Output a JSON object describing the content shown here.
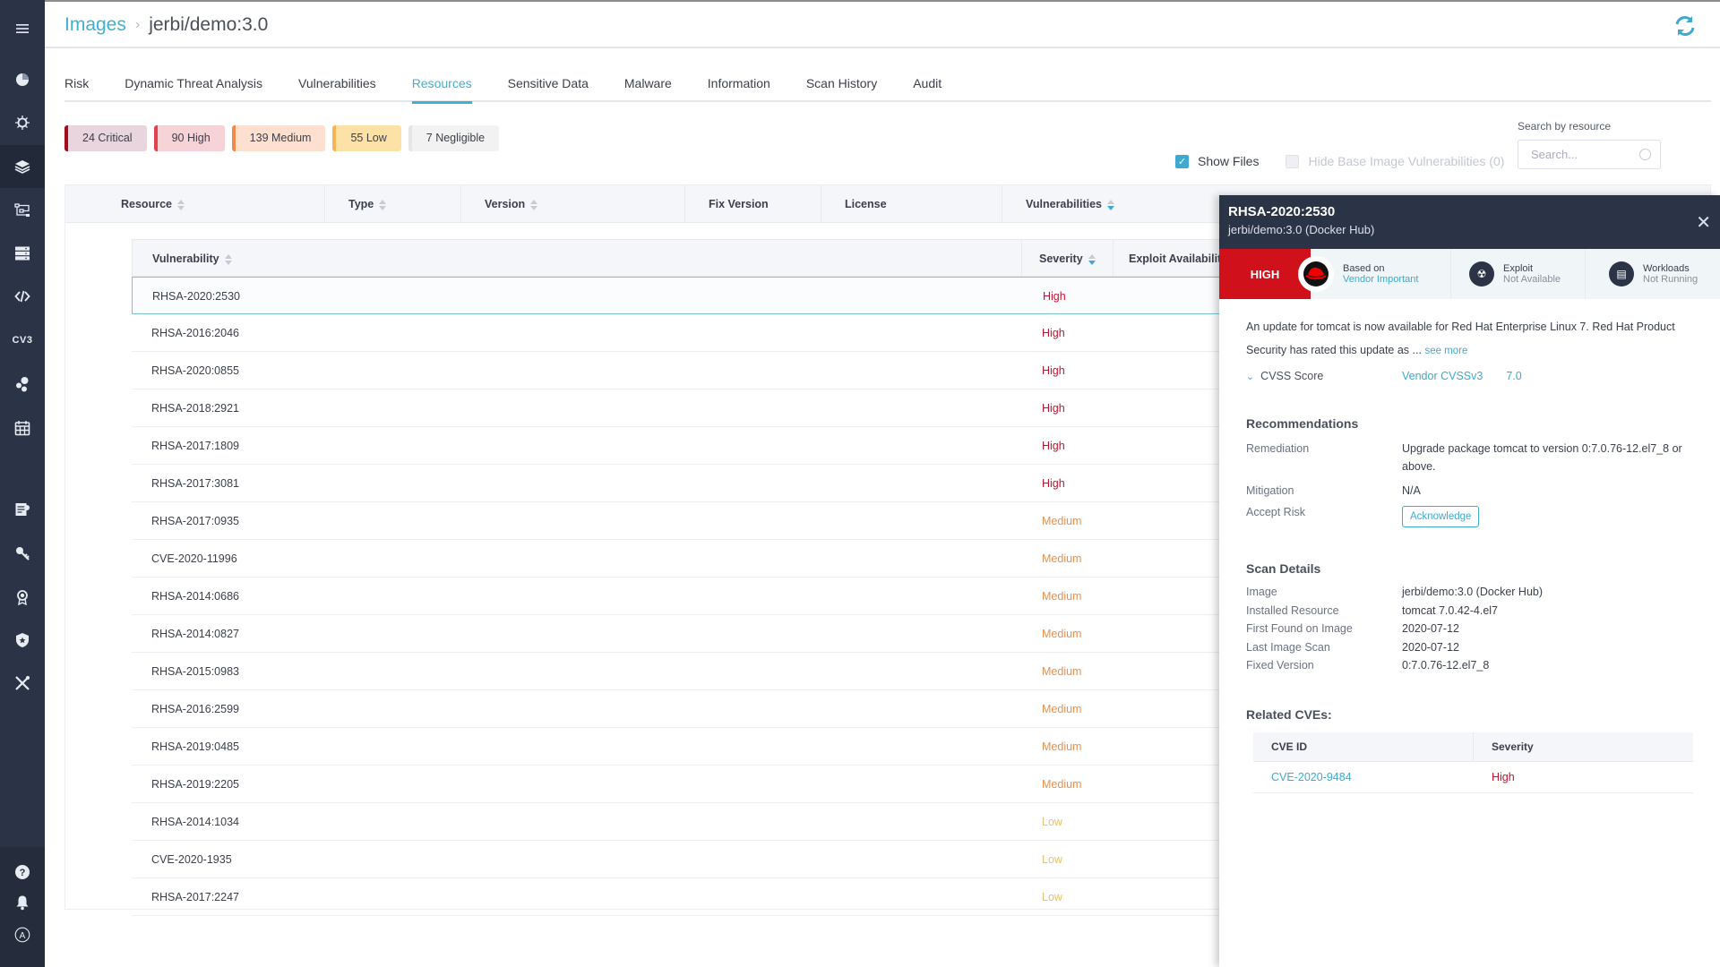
{
  "sidebar": {
    "items": [
      {
        "name": "menu-icon"
      },
      {
        "name": "dashboard-icon"
      },
      {
        "name": "risk-explorer-icon"
      },
      {
        "name": "images-icon",
        "active": true
      },
      {
        "name": "workloads-icon"
      },
      {
        "name": "infrastructure-icon"
      },
      {
        "name": "functions-icon"
      },
      {
        "name": "vmware-icon",
        "label": "CV3"
      },
      {
        "name": "services-icon"
      },
      {
        "name": "audit-calendar-icon"
      },
      {
        "name": "policies-icon"
      },
      {
        "name": "secrets-key-icon"
      },
      {
        "name": "compliance-icon"
      },
      {
        "name": "security-icon"
      },
      {
        "name": "settings-tools-icon"
      }
    ],
    "bottom": [
      {
        "name": "help-icon"
      },
      {
        "name": "notifications-icon"
      },
      {
        "name": "account-icon",
        "label": "A"
      }
    ]
  },
  "header": {
    "breadcrumb_root": "Images",
    "breadcrumb_current": "jerbi/demo:3.0"
  },
  "tabs": [
    {
      "label": "Risk"
    },
    {
      "label": "Dynamic Threat Analysis"
    },
    {
      "label": "Vulnerabilities"
    },
    {
      "label": "Resources",
      "active": true
    },
    {
      "label": "Sensitive Data"
    },
    {
      "label": "Malware"
    },
    {
      "label": "Information"
    },
    {
      "label": "Scan History"
    },
    {
      "label": "Audit"
    }
  ],
  "severity_chips": [
    {
      "label": "24 Critical",
      "bg": "#e9d5de",
      "border": "#a40c1e"
    },
    {
      "label": "90 High",
      "bg": "#f6d3d6",
      "border": "#e0434f"
    },
    {
      "label": "139 Medium",
      "bg": "#fde0d0",
      "border": "#f08a4a"
    },
    {
      "label": "55 Low",
      "bg": "#fde2a8",
      "border": "#f7b457"
    },
    {
      "label": "7 Negligible",
      "bg": "#f2f2f2",
      "border": "#e6e6e6"
    }
  ],
  "filters": {
    "show_files": "Show Files",
    "show_files_checked": true,
    "hide_base": "Hide Base Image Vulnerabilities (0)",
    "hide_base_checked": false,
    "search_label": "Search by resource",
    "search_placeholder": "Search..."
  },
  "resource_table": {
    "columns": [
      "Resource",
      "Type",
      "Version",
      "Fix Version",
      "License",
      "Vulnerabilities"
    ]
  },
  "vuln_table": {
    "columns": [
      "Vulnerability",
      "Severity",
      "Exploit Availability"
    ],
    "rows": [
      {
        "id": "RHSA-2020:2530",
        "severity": "High",
        "selected": true
      },
      {
        "id": "RHSA-2016:2046",
        "severity": "High"
      },
      {
        "id": "RHSA-2020:0855",
        "severity": "High"
      },
      {
        "id": "RHSA-2018:2921",
        "severity": "High"
      },
      {
        "id": "RHSA-2017:1809",
        "severity": "High"
      },
      {
        "id": "RHSA-2017:3081",
        "severity": "High"
      },
      {
        "id": "RHSA-2017:0935",
        "severity": "Medium"
      },
      {
        "id": "CVE-2020-11996",
        "severity": "Medium"
      },
      {
        "id": "RHSA-2014:0686",
        "severity": "Medium"
      },
      {
        "id": "RHSA-2014:0827",
        "severity": "Medium"
      },
      {
        "id": "RHSA-2015:0983",
        "severity": "Medium"
      },
      {
        "id": "RHSA-2016:2599",
        "severity": "Medium"
      },
      {
        "id": "RHSA-2019:0485",
        "severity": "Medium"
      },
      {
        "id": "RHSA-2019:2205",
        "severity": "Medium"
      },
      {
        "id": "RHSA-2014:1034",
        "severity": "Low"
      },
      {
        "id": "CVE-2020-1935",
        "severity": "Low"
      },
      {
        "id": "RHSA-2017:2247",
        "severity": "Low"
      }
    ]
  },
  "panel": {
    "title": "RHSA-2020:2530",
    "subtitle": "jerbi/demo:3.0 (Docker Hub)",
    "severity": "HIGH",
    "based_on_label": "Based on",
    "based_on_value": "Vendor Important",
    "exploit_label": "Exploit",
    "exploit_value": "Not Available",
    "workloads_label": "Workloads",
    "workloads_value": "Not Running",
    "description": "An update for tomcat is now available for Red Hat Enterprise Linux 7. Red Hat Product Security has rated this update as ...",
    "see_more": "see more",
    "cvss_label": "CVSS Score",
    "cvss_source": "Vendor CVSSv3",
    "cvss_value": "7.0",
    "recommendations_title": "Recommendations",
    "remediation_label": "Remediation",
    "remediation_value": "Upgrade package tomcat to version 0:7.0.76-12.el7_8 or above.",
    "mitigation_label": "Mitigation",
    "mitigation_value": "N/A",
    "accept_risk_label": "Accept Risk",
    "acknowledge": "Acknowledge",
    "scan_details_title": "Scan Details",
    "scan_details": [
      {
        "k": "Image",
        "v": "jerbi/demo:3.0 (Docker Hub)",
        "link": true
      },
      {
        "k": "Installed Resource",
        "v": "tomcat 7.0.42-4.el7"
      },
      {
        "k": "First Found on Image",
        "v": "2020-07-12"
      },
      {
        "k": "Last Image Scan",
        "v": "2020-07-12"
      },
      {
        "k": "Fixed Version",
        "v": "0:7.0.76-12.el7_8"
      }
    ],
    "related_title": "Related CVEs:",
    "related_columns": [
      "CVE ID",
      "Severity"
    ],
    "related": [
      {
        "id": "CVE-2020-9484",
        "severity": "High"
      }
    ]
  }
}
